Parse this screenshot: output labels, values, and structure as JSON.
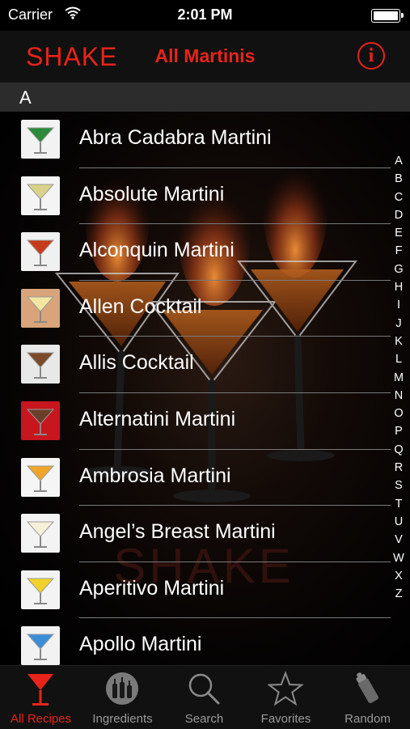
{
  "status": {
    "carrier": "Carrier",
    "time": "2:01 PM"
  },
  "nav": {
    "logo": "SHAKE",
    "title": "All Martinis",
    "info_glyph": "i"
  },
  "section": {
    "header": "A"
  },
  "recipes": [
    {
      "name": "Abra Cadabra Martini",
      "thumb_bg": "#f2f2f2",
      "drink": "#2c8a3a"
    },
    {
      "name": "Absolute Martini",
      "thumb_bg": "#f4f4f4",
      "drink": "#d9d38a"
    },
    {
      "name": "Alconquin Martini",
      "thumb_bg": "#f0f0f0",
      "drink": "#c83a1a"
    },
    {
      "name": "Allen Cocktail",
      "thumb_bg": "#d9a47a",
      "drink": "#f2e6a0"
    },
    {
      "name": "Allis Cocktail",
      "thumb_bg": "#e8e8e8",
      "drink": "#7a4a2a"
    },
    {
      "name": "Alternatini Martini",
      "thumb_bg": "#c8161e",
      "drink": "#6a3e2a"
    },
    {
      "name": "Ambrosia Martini",
      "thumb_bg": "#f5f5f5",
      "drink": "#f0a52a"
    },
    {
      "name": "Angel’s Breast Martini",
      "thumb_bg": "#f3f3f3",
      "drink": "#f7f0d8"
    },
    {
      "name": "Aperitivo Martini",
      "thumb_bg": "#f3f3f3",
      "drink": "#f0d22a"
    },
    {
      "name": "Apollo Martini",
      "thumb_bg": "#f2f2f2",
      "drink": "#3a8ed8"
    }
  ],
  "index_letters": [
    "A",
    "B",
    "C",
    "D",
    "E",
    "F",
    "G",
    "H",
    "I",
    "J",
    "K",
    "L",
    "M",
    "N",
    "O",
    "P",
    "Q",
    "R",
    "S",
    "T",
    "U",
    "V",
    "W",
    "X",
    "Z"
  ],
  "watermark": "SHAKE",
  "tabs": [
    {
      "label": "All Recipes",
      "icon": "martini-glass-icon",
      "active": true
    },
    {
      "label": "Ingredients",
      "icon": "bottles-icon",
      "active": false
    },
    {
      "label": "Search",
      "icon": "magnifier-icon",
      "active": false
    },
    {
      "label": "Favorites",
      "icon": "star-icon",
      "active": false
    },
    {
      "label": "Random",
      "icon": "shaker-icon",
      "active": false
    }
  ],
  "colors": {
    "accent": "#e8231a",
    "tab_inactive": "#9a9a9a",
    "separator": "#7a7a7a"
  }
}
